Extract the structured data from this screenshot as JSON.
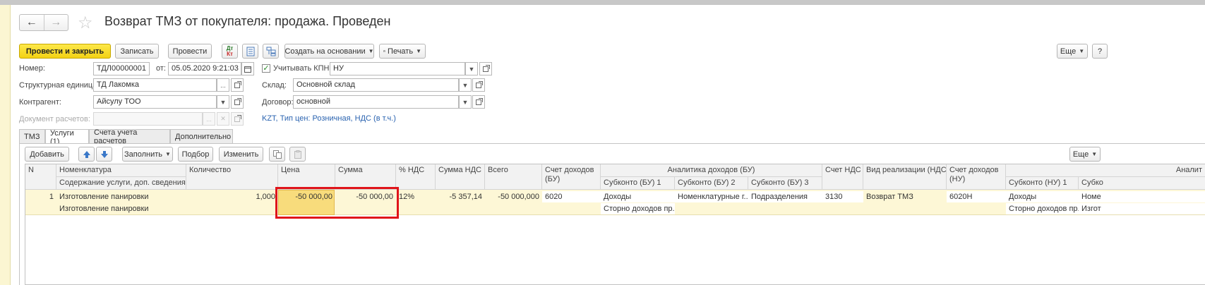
{
  "title": "Возврат ТМЗ от покупателя: продажа. Проведен",
  "toolbar": {
    "post_close": "Провести и закрыть",
    "save": "Записать",
    "post": "Провести",
    "dtkt_top": "Дт",
    "dtkt_bottom": "Кт",
    "create_based": "Создать на основании",
    "print": "Печать",
    "more": "Еще",
    "help": "?"
  },
  "form": {
    "number_label": "Номер:",
    "number_value": "ТДЛ00000001",
    "date_label": "от:",
    "date_value": "05.05.2020  9:21:03",
    "kpn_label": "Учитывать КПН",
    "kpn_value": "НУ",
    "unit_label": "Структурная единица:",
    "unit_value": "ТД Лакомка",
    "warehouse_label": "Склад:",
    "warehouse_value": "Основной склад",
    "counterparty_label": "Контрагент:",
    "counterparty_value": "Айсулу ТОО",
    "contract_label": "Договор:",
    "contract_value": "основной",
    "settlement_doc_label": "Документ расчетов:",
    "settlement_doc_value": "",
    "price_info": "KZT, Тип цен: Розничная, НДС (в т.ч.)"
  },
  "tabs": [
    "ТМЗ",
    "Услуги (1)",
    "Счета учета расчетов",
    "Дополнительно"
  ],
  "table_toolbar": {
    "add": "Добавить",
    "fill": "Заполнить",
    "pick": "Подбор",
    "change": "Изменить",
    "more": "Еще"
  },
  "table": {
    "headers": {
      "n": "N",
      "nomenclature": "Номенклатура",
      "content": "Содержание услуги, доп. сведения",
      "qty": "Количество",
      "price": "Цена",
      "sum": "Сумма",
      "vat_pct": "% НДС",
      "vat_sum": "Сумма НДС",
      "total": "Всего",
      "income_acc_bu": "Счет доходов (БУ)",
      "analytics_bu": "Аналитика доходов (БУ)",
      "sub_bu1": "Субконто (БУ) 1",
      "sub_bu2": "Субконто (БУ) 2",
      "sub_bu3": "Субконто (БУ) 3",
      "vat_acc": "Счет НДС",
      "sale_type": "Вид реализации (НДС)",
      "income_acc_nu": "Счет доходов (НУ)",
      "analytics_nu": "Аналит",
      "sub_nu1": "Субконто (НУ) 1",
      "sub_nu2": "Субко"
    },
    "row": {
      "n": "1",
      "nomenclature": "Изготовление панировки",
      "content": "Изготовление панировки",
      "qty": "1,000",
      "price": "-50 000,00",
      "sum": "-50 000,00",
      "vat_pct": "12%",
      "vat_sum": "-5 357,14",
      "total": "-50 000,000",
      "income_acc_bu": "6020",
      "sub_bu1_a": "Доходы",
      "sub_bu1_b": "Сторно доходов пр...",
      "sub_bu2": "Номенклатурные г...",
      "sub_bu3": "Подразделения",
      "vat_acc": "3130",
      "sale_type": "Возврат ТМЗ",
      "income_acc_nu": "6020Н",
      "sub_nu1_a": "Доходы",
      "sub_nu1_b": "Сторно доходов пр...",
      "sub_nu2_a": "Номе",
      "sub_nu2_b": "Изгот"
    }
  }
}
